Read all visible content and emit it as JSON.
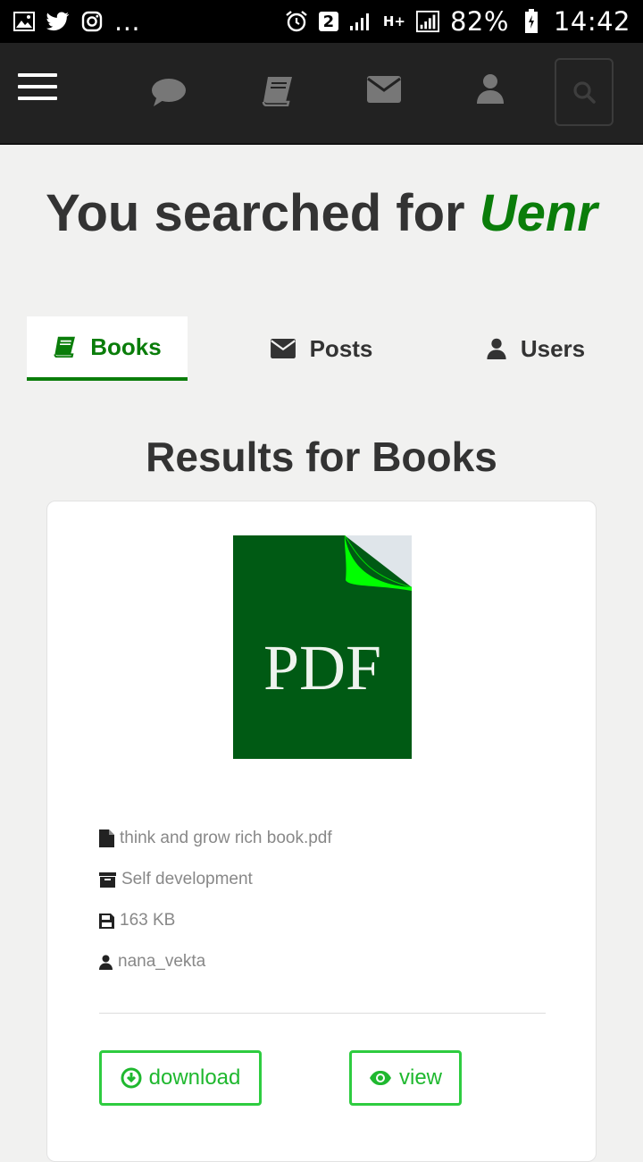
{
  "status_bar": {
    "overflow": "...",
    "sim_badge": "2",
    "network": "H+",
    "battery": "82%",
    "time": "14:42"
  },
  "navbar": {
    "icons": [
      "menu-icon",
      "chat-icon",
      "book-icon",
      "envelope-icon",
      "user-icon",
      "search-icon"
    ]
  },
  "search": {
    "prefix": "You searched for ",
    "term": "Uenr"
  },
  "tabs": [
    {
      "label": "Books",
      "icon": "book-icon",
      "active": true
    },
    {
      "label": "Posts",
      "icon": "envelope-icon",
      "active": false
    },
    {
      "label": "Users",
      "icon": "user-icon",
      "active": false
    }
  ],
  "results": {
    "title": "Results for Books",
    "items": [
      {
        "thumbnail_text": "PDF",
        "filename": "think and grow rich book.pdf",
        "category": "Self development",
        "size": "163 KB",
        "uploader": "nana_vekta",
        "download_label": "download",
        "view_label": "view"
      }
    ]
  },
  "colors": {
    "accent": "#0a7d0a",
    "button_green": "#2ecc40",
    "navbar": "#222222",
    "pdf_green": "#005a14",
    "pdf_corner": "#00ff00"
  }
}
